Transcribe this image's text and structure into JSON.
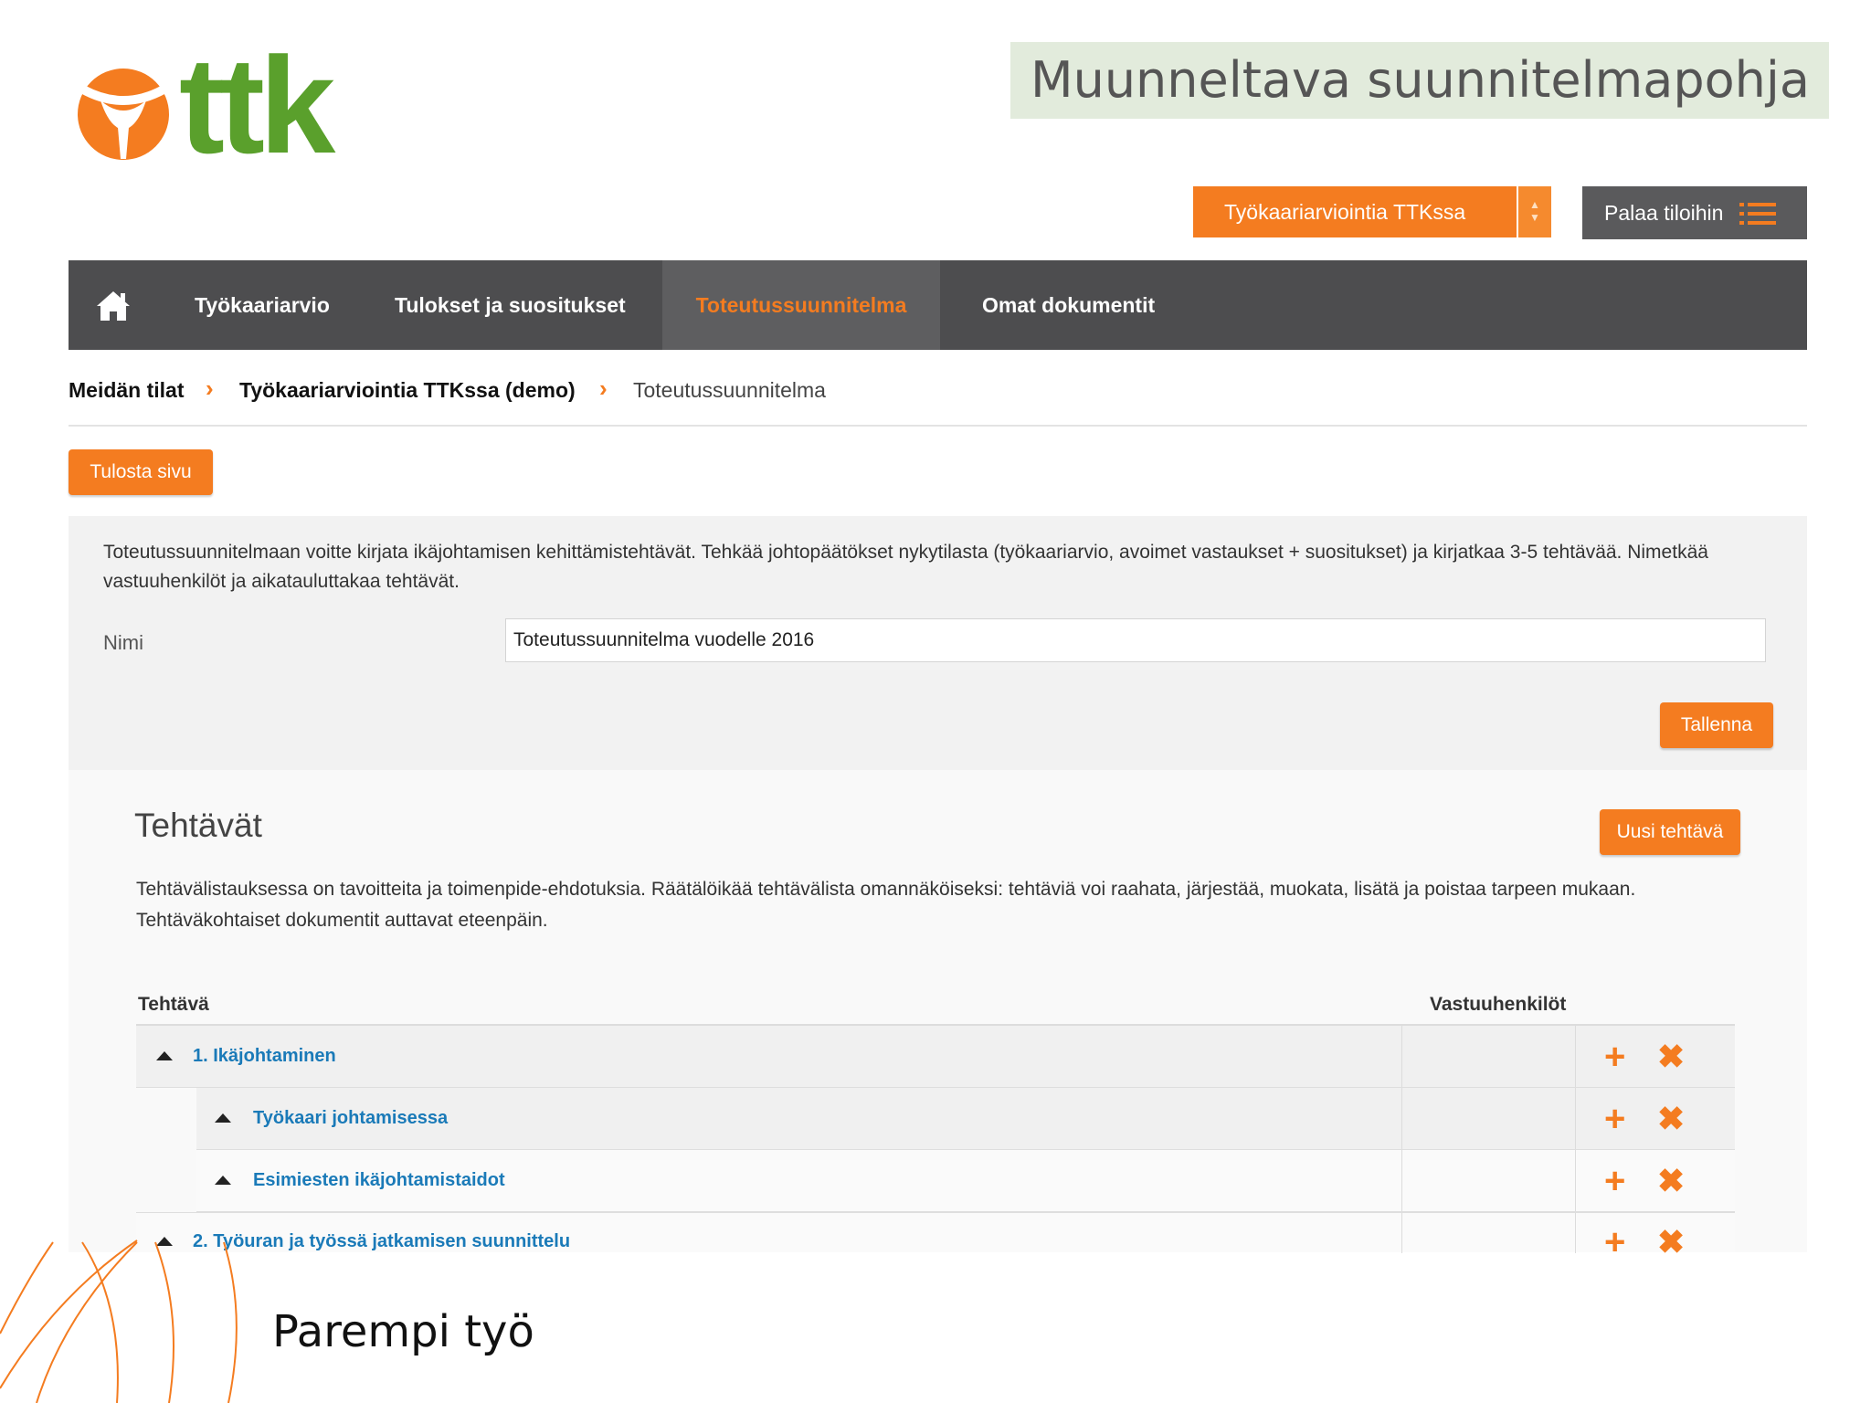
{
  "brand": {
    "logo_text": "ttk",
    "colors": {
      "orange": "#f47c20",
      "green": "#5aa02c",
      "nav_bg": "#4d4d4f",
      "link_blue": "#1a7ab8"
    }
  },
  "header": {
    "title": "Muunneltava suunnitelmapohja",
    "space_selector": {
      "value": "Työkaariarviointia TTKssa"
    },
    "back_button": {
      "label": "Palaa tiloihin",
      "icon": "list-icon"
    }
  },
  "nav": {
    "home_icon": "home-icon",
    "items": [
      {
        "label": "Työkaariarvio"
      },
      {
        "label": "Tulokset ja suositukset"
      },
      {
        "label": "Toteutussuunnitelma",
        "active": true
      },
      {
        "label": "Omat dokumentit"
      }
    ]
  },
  "breadcrumb": {
    "items": [
      "Meidän tilat",
      "Työkaariarviointia TTKssa (demo)",
      "Toteutussuunnitelma"
    ],
    "separator": "›"
  },
  "print_button": {
    "label": "Tulosta sivu"
  },
  "plan_panel": {
    "intro": "Toteutussuunnitelmaan voitte kirjata ikäjohtamisen kehittämistehtävät. Tehkää johtopäätökset nykytilasta (työkaariarvio, avoimet vastaukset + suositukset) ja kirjatkaa 3-5 tehtävää. Nimetkää vastuuhenkilöt ja aikatauluttakaa tehtävät.",
    "name_label": "Nimi",
    "name_value": "Toteutussuunnitelma vuodelle 2016",
    "save_label": "Tallenna"
  },
  "tasks": {
    "heading": "Tehtävät",
    "new_task_label": "Uusi tehtävä",
    "description": "Tehtävälistauksessa on tavoitteita ja toimenpide-ehdotuksia. Räätälöikää tehtävälista omannäköiseksi: tehtäviä voi raahata, järjestää, muokata, lisätä ja poistaa tarpeen mukaan. Tehtäväkohtaiset dokumentit auttavat eteenpäin.",
    "columns": {
      "task": "Tehtävä",
      "responsible": "Vastuuhenkilöt"
    },
    "rows": [
      {
        "label": "1. Ikäjohtaminen",
        "level": 0,
        "add_icon": "+",
        "delete_icon": "✖"
      },
      {
        "label": "Työkaari johtamisessa",
        "level": 1,
        "add_icon": "+",
        "delete_icon": "✖"
      },
      {
        "label": "Esimiesten ikäjohtamistaidot",
        "level": 1,
        "add_icon": "+",
        "delete_icon": "✖"
      },
      {
        "label": "2. Työuran ja työssä jatkamisen suunnittelu",
        "level": 0,
        "add_icon": "+",
        "delete_icon": "✖"
      }
    ]
  },
  "footer": {
    "slogan": "Parempi työ"
  }
}
